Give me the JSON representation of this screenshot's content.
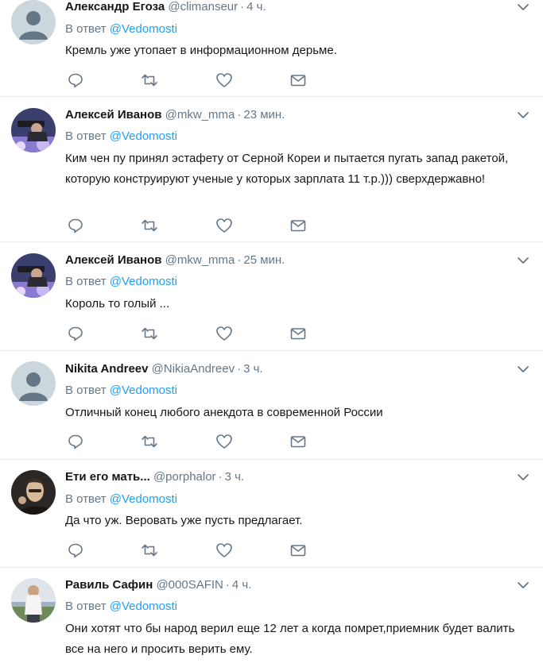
{
  "feed": {
    "reply_prefix": "В ответ",
    "tweets": [
      {
        "name": "Александр Егоза",
        "handle": "@climanseur",
        "time": "4 ч.",
        "mention": "@Vedomosti",
        "text": "Кремль уже утопает в информационном дерьме.",
        "avatar": "default-avatar"
      },
      {
        "name": "Алексей Иванов",
        "handle": "@mkw_mma",
        "time": "23 мин.",
        "mention": "@Vedomosti",
        "text": "Ким чен пу принял эстафету от Серной Кореи и пытается пугать запад ракетой, которую конструируют ученые у которых зарплата 11 т.р.))) сверхдержавно!",
        "avatar": "photo-avatar"
      },
      {
        "name": "Алексей Иванов",
        "handle": "@mkw_mma",
        "time": "25 мин.",
        "mention": "@Vedomosti",
        "text": "Король то голый ...",
        "avatar": "photo-avatar"
      },
      {
        "name": "Nikita Andreev",
        "handle": "@NikiaAndreev",
        "time": "3 ч.",
        "mention": "@Vedomosti",
        "text": "Отличный конец любого анекдота в современной России",
        "avatar": "default-avatar"
      },
      {
        "name": "Ети его мать...",
        "handle": "@porphalor",
        "time": "3 ч.",
        "mention": "@Vedomosti",
        "text": "Да что уж. Веровать уже пусть предлагает.",
        "avatar": "photo-avatar"
      },
      {
        "name": "Равиль Сафин",
        "handle": "@000SAFIN",
        "time": "4 ч.",
        "mention": "@Vedomosti",
        "text": "Они хотят что бы народ верил еще 12 лет а когда помрет,приемник будет валить все на него и просить верить ему.",
        "avatar": "photo-avatar"
      }
    ]
  },
  "icons": {
    "reply": "reply-icon",
    "retweet": "retweet-icon",
    "like": "heart-icon",
    "message": "envelope-icon",
    "more": "chevron-down-icon"
  },
  "colors": {
    "link": "#1da1f2",
    "secondary_text": "#657786",
    "icon": "#657786",
    "divider": "#e6ecf0",
    "default_avatar_bg": "#ccd6dd"
  }
}
